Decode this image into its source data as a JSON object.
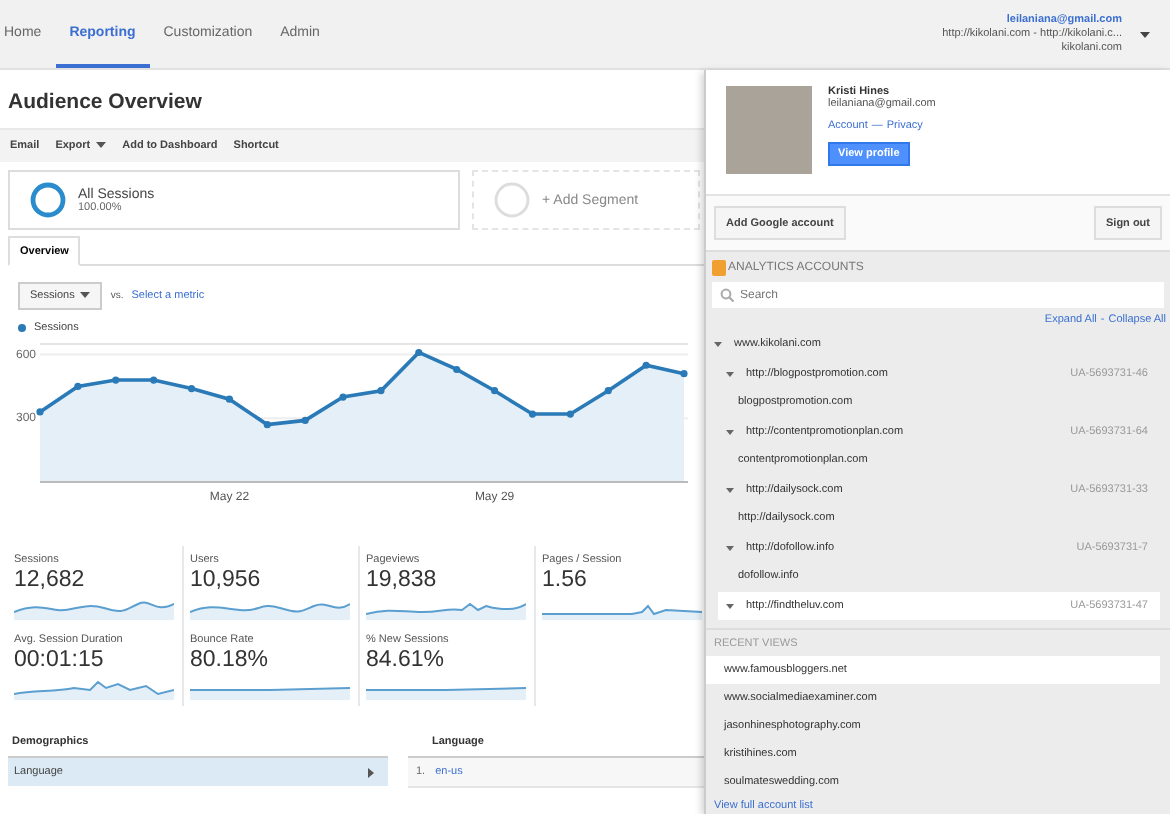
{
  "nav": {
    "tabs": [
      {
        "label": "Home",
        "selected": false
      },
      {
        "label": "Reporting",
        "selected": true
      },
      {
        "label": "Customization",
        "selected": false
      },
      {
        "label": "Admin",
        "selected": false
      }
    ],
    "account": {
      "email": "leilaniana@gmail.com",
      "property": "http://kikolani.com - http://kikolani.c...",
      "view": "kikolani.com"
    }
  },
  "page": {
    "title": "Audience Overview",
    "toolbar": [
      {
        "label": "Email",
        "dropdown": false
      },
      {
        "label": "Export",
        "dropdown": true
      },
      {
        "label": "Add to Dashboard",
        "dropdown": false
      },
      {
        "label": "Shortcut",
        "dropdown": false
      }
    ],
    "segments": [
      {
        "kind": "active",
        "label": "All Sessions",
        "detail": "100.00%"
      },
      {
        "kind": "add",
        "label": "+ Add Segment"
      }
    ],
    "tabs": [
      {
        "label": "Overview",
        "selected": true
      }
    ],
    "metric_selector": {
      "value": "Sessions",
      "vs": "vs.",
      "link": "Select a metric"
    },
    "chart": {
      "chart_data": {
        "type": "area",
        "categories": [
          null,
          null,
          null,
          null,
          null,
          "May 22",
          null,
          null,
          null,
          null,
          null,
          null,
          "May 29",
          null,
          null,
          null,
          null,
          null
        ],
        "series": [
          {
            "name": "Sessions",
            "color": "#2a7ab8",
            "values": [
              330,
              450,
              480,
              480,
              440,
              390,
              270,
              290,
              400,
              430,
              610,
              530,
              430,
              320,
              320,
              430,
              550,
              510
            ]
          }
        ],
        "ylim": [
          0,
          650
        ],
        "yticks": [
          300,
          600
        ]
      }
    },
    "metrics": [
      {
        "label": "Sessions",
        "value": "12,682"
      },
      {
        "label": "Users",
        "value": "10,956"
      },
      {
        "label": "Pageviews",
        "value": "19,838"
      },
      {
        "label": "Pages / Session",
        "value": "1.56"
      },
      {
        "label": "Avg. Session Duration",
        "value": "00:01:15"
      },
      {
        "label": "Bounce Rate",
        "value": "80.18%"
      },
      {
        "label": "% New Sessions",
        "value": "84.61%"
      }
    ],
    "demographics": {
      "title": "Demographics",
      "items": [
        {
          "label": "Language",
          "selected": true
        }
      ]
    },
    "language": {
      "title": "Language",
      "rows": [
        {
          "rank": "1.",
          "value": "en-us"
        }
      ]
    }
  },
  "panel": {
    "profile": {
      "name": "Kristi Hines",
      "email": "leilaniana@gmail.com",
      "links": [
        "Account",
        "—",
        "Privacy"
      ],
      "button": "View profile"
    },
    "buttons": [
      "Add Google account",
      "Sign out"
    ],
    "accounts": {
      "title": "ANALYTICS ACCOUNTS",
      "search_placeholder": "Search",
      "expand": "Expand All",
      "separator": "-",
      "collapse": "Collapse All",
      "tree": [
        {
          "label": "www.kikolani.com",
          "expanded": true,
          "children": [
            {
              "label": "http://blogpostpromotion.com",
              "id": "UA-5693731-46",
              "expanded": true,
              "hovered": false,
              "children": [
                {
                  "label": "blogpostpromotion.com"
                }
              ]
            },
            {
              "label": "http://contentpromotionplan.com",
              "id": "UA-5693731-64",
              "expanded": true,
              "hovered": false,
              "children": [
                {
                  "label": "contentpromotionplan.com"
                }
              ]
            },
            {
              "label": "http://dailysock.com",
              "id": "UA-5693731-33",
              "expanded": true,
              "hovered": false,
              "children": [
                {
                  "label": "http://dailysock.com"
                }
              ]
            },
            {
              "label": "http://dofollow.info",
              "id": "UA-5693731-7",
              "expanded": true,
              "hovered": false,
              "children": [
                {
                  "label": "dofollow.info"
                }
              ]
            },
            {
              "label": "http://findtheluv.com",
              "id": "UA-5693731-47",
              "expanded": true,
              "hovered": true
            }
          ]
        }
      ]
    },
    "recent": {
      "title": "RECENT VIEWS",
      "items": [
        {
          "label": "www.famousbloggers.net",
          "hovered": true
        },
        {
          "label": "www.socialmediaexaminer.com",
          "hovered": false
        },
        {
          "label": "jasonhinesphotography.com",
          "hovered": false
        },
        {
          "label": "kristihines.com",
          "hovered": false
        },
        {
          "label": "soulmateswedding.com",
          "hovered": false
        }
      ],
      "link": "View full account list"
    }
  }
}
